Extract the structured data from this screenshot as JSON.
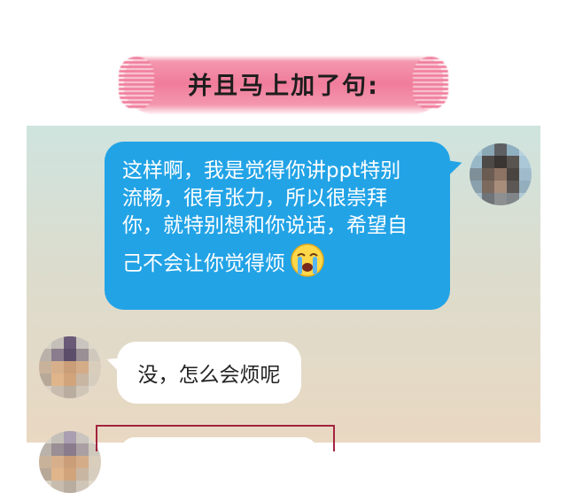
{
  "caption": {
    "text": "并且马上加了句:"
  },
  "messages": {
    "sent": {
      "lines": [
        "这样啊，我是觉得你讲ppt特别",
        "流畅，很有张力，所以很崇拜",
        "你，就特别想和你说话，希望自",
        "己不会让你觉得烦"
      ],
      "emoji": "crying-face"
    },
    "received": {
      "text": "没，怎么会烦呢"
    }
  },
  "colors": {
    "sent_bubble": "#22a3e6",
    "received_bubble": "#ffffff",
    "caption_brush": "#f07c9b",
    "highlight_border": "#a3243f"
  }
}
